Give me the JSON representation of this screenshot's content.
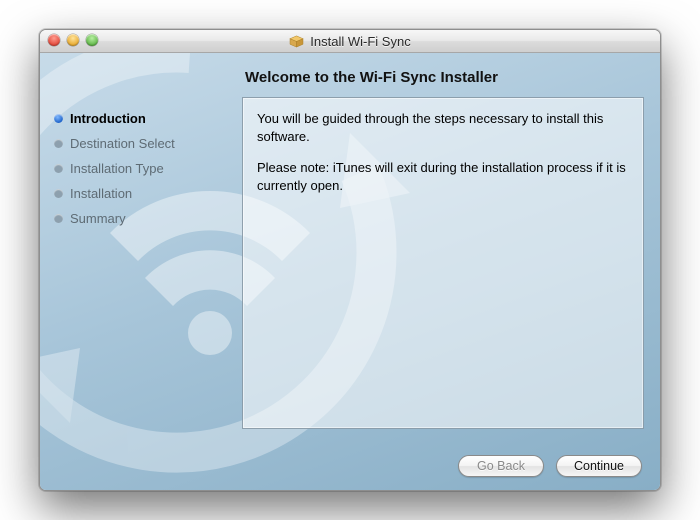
{
  "titlebar": {
    "title": "Install Wi-Fi Sync",
    "icon": "package-icon"
  },
  "heading": "Welcome to the Wi-Fi Sync Installer",
  "content": {
    "para1": "You will be guided through the steps necessary to install this software.",
    "para2": "Please note: iTunes will exit during the installation process if it is currently open."
  },
  "sidebar": {
    "steps": [
      {
        "label": "Introduction",
        "active": true
      },
      {
        "label": "Destination Select",
        "active": false
      },
      {
        "label": "Installation Type",
        "active": false
      },
      {
        "label": "Installation",
        "active": false
      },
      {
        "label": "Summary",
        "active": false
      }
    ]
  },
  "buttons": {
    "back": "Go Back",
    "continue": "Continue"
  },
  "colors": {
    "accent": "#1e63c9",
    "bg_top": "#c7dbe9",
    "bg_bottom": "#88aec6"
  }
}
